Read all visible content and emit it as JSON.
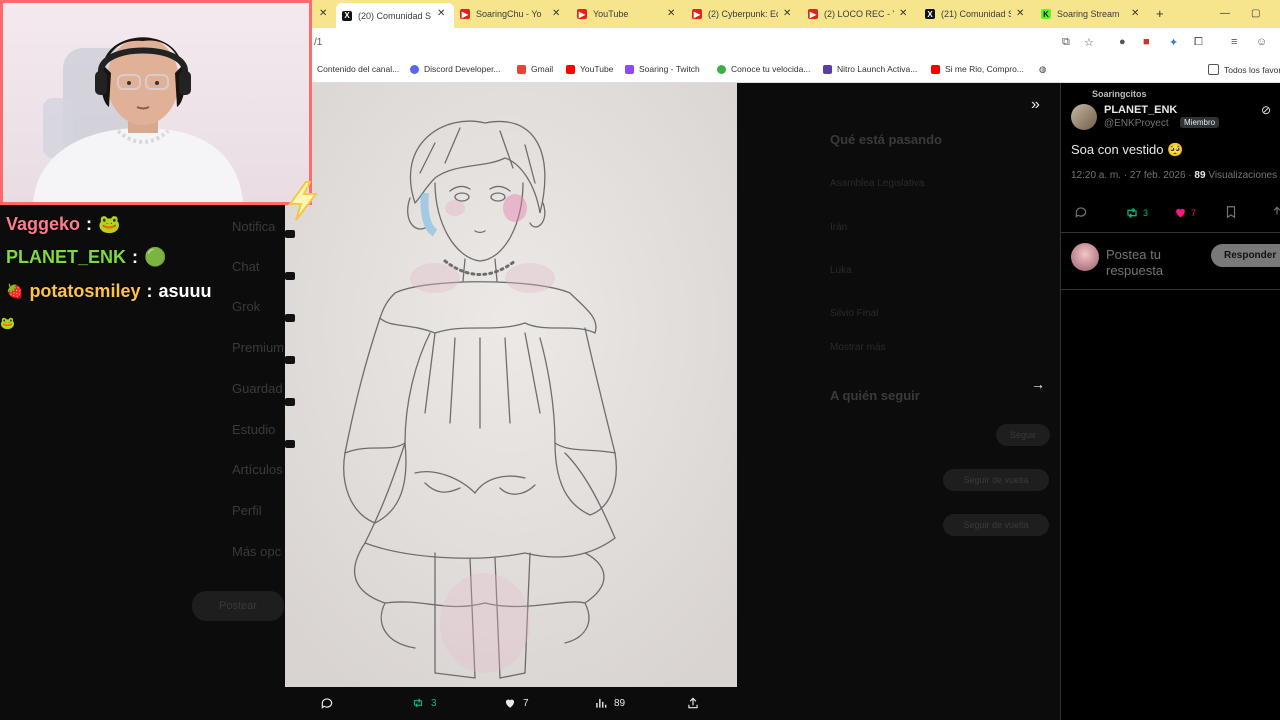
{
  "browser": {
    "tabs": [
      {
        "label": "(20) Comunidad S",
        "icon": "x-logo-icon",
        "active": true
      },
      {
        "label": "SoaringChu - Yo",
        "icon": "youtube-icon"
      },
      {
        "label": "YouTube",
        "icon": "youtube-icon"
      },
      {
        "label": "(2) Cyberpunk: Ed",
        "icon": "youtube-icon"
      },
      {
        "label": "(2) LOCO REC - Yo",
        "icon": "youtube-icon"
      },
      {
        "label": "(21) Comunidad S",
        "icon": "x-logo-icon"
      },
      {
        "label": "Soaring Stream",
        "icon": "kick-icon"
      }
    ],
    "url_fragment": "/1",
    "bookmarks": [
      {
        "label": "Contenido del canal...",
        "color": "#ff0000"
      },
      {
        "label": "Discord Developer...",
        "color": "#5865f2"
      },
      {
        "label": "Gmail",
        "color": "#ea4335"
      },
      {
        "label": "YouTube",
        "color": "#ff0000"
      },
      {
        "label": "Soaring - Twitch",
        "color": "#9146ff"
      },
      {
        "label": "Conoce tu velocida...",
        "color": "#3cb043"
      },
      {
        "label": "Nitro Launch Activa...",
        "color": "#5a3fa3"
      },
      {
        "label": "Si me Rio, Compro...",
        "color": "#ff0000"
      }
    ],
    "all_bookmarks_label": "Todos los favor"
  },
  "x_page": {
    "sidebar_items": [
      "Notifica",
      "Chat",
      "Grok",
      "Premium",
      "Guardad",
      "Estudio",
      "Artículos",
      "Perfil",
      "Más opc"
    ],
    "post_button": "Postear",
    "trending_title": "Qué está pasando",
    "trends": [
      "Asamblea Legislativa",
      "Irán",
      "Luka",
      "Silvio Final",
      "Mostrar más"
    ],
    "follow_title": "A quién seguir",
    "follow_follow_button": "Seguir",
    "follow_back_button": "Seguir de vuelta"
  },
  "media_viewer": {
    "reply_count": "",
    "repost_count": "3",
    "like_count": "7",
    "view_count": "89"
  },
  "post": {
    "community": "Soaringcitos",
    "author_name": "PLANET_ENK",
    "author_handle": "@ENKProyect",
    "member_badge": "Miembro",
    "text": "Soa con vestido",
    "emoji": "🥺",
    "time": "12:20 a. m. · 27 feb. 2026 ·",
    "views_count": "89",
    "views_label": "Visualizaciones",
    "repost_count": "3",
    "like_count": "7",
    "reply_placeholder": "Postea tu respuesta",
    "reply_button": "Responder"
  },
  "chat": [
    {
      "user": "Vaggeko",
      "sep": ":",
      "msg": "🐸",
      "color": "#ff7b8a"
    },
    {
      "user": "PLANET_ENK",
      "sep": ":",
      "msg": "🟢",
      "color": "#7ddb3b"
    },
    {
      "user": "potatosmiley",
      "sep": ":",
      "msg": "asuuu",
      "color": "#ffc247",
      "badge": "🍓"
    }
  ],
  "colors": {
    "accent_pink": "#f91880",
    "repost_green": "#00ba7c",
    "webcam_border": "#ff6b6b",
    "tabbar": "#f6e58d"
  }
}
